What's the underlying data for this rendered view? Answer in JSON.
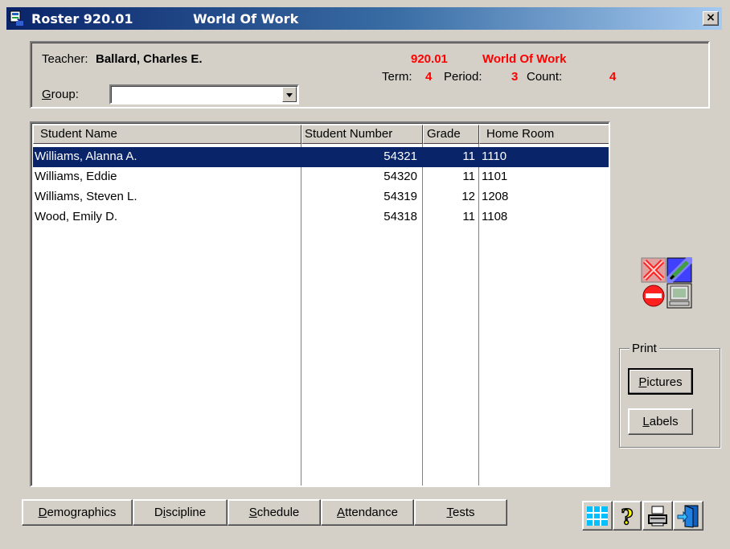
{
  "window": {
    "title": "Roster 920.01",
    "subtitle": "World Of Work",
    "close_label": "×"
  },
  "header": {
    "teacher_label": "Teacher:",
    "teacher_name": "Ballard, Charles E.",
    "group_label_first": "G",
    "group_label_rest": "roup:",
    "group_value": "",
    "course_number": "920.01",
    "course_name": "World Of Work",
    "term_label": "Term:",
    "term_value": "4",
    "period_label": "Period:",
    "period_value": "3",
    "count_label": "Count:",
    "count_value": "4"
  },
  "grid": {
    "columns": [
      "Student Name",
      "Student Number",
      "Grade",
      "Home Room"
    ],
    "rows": [
      {
        "name": "Williams, Alanna A.",
        "number": "54321",
        "grade": "11",
        "room": "1110",
        "selected": true
      },
      {
        "name": "Williams, Eddie",
        "number": "54320",
        "grade": "11",
        "room": "1101",
        "selected": false
      },
      {
        "name": "Williams, Steven L.",
        "number": "54319",
        "grade": "12",
        "room": "1208",
        "selected": false
      },
      {
        "name": "Wood, Emily D.",
        "number": "54318",
        "grade": "11",
        "room": "1108",
        "selected": false
      }
    ]
  },
  "print": {
    "legend": "Print",
    "pictures_first": "P",
    "pictures_rest": "ictures",
    "labels_first": "L",
    "labels_rest": "abels"
  },
  "tabs": [
    {
      "first": "D",
      "rest": "emographics"
    },
    {
      "pre": "D",
      "u": "i",
      "post": "scipline"
    },
    {
      "first": "S",
      "rest": "chedule"
    },
    {
      "first": "A",
      "rest": "ttendance"
    },
    {
      "first": "T",
      "rest": "ests"
    }
  ],
  "icons": [
    "delete-icon",
    "edit-icon",
    "stop-icon",
    "screen-icon",
    "grid-icon",
    "help-icon",
    "printer-icon",
    "exit-door-icon"
  ],
  "colors": {
    "accent_red": "#ff0000",
    "selection": "#0a246a",
    "title_start": "#0a246a"
  }
}
